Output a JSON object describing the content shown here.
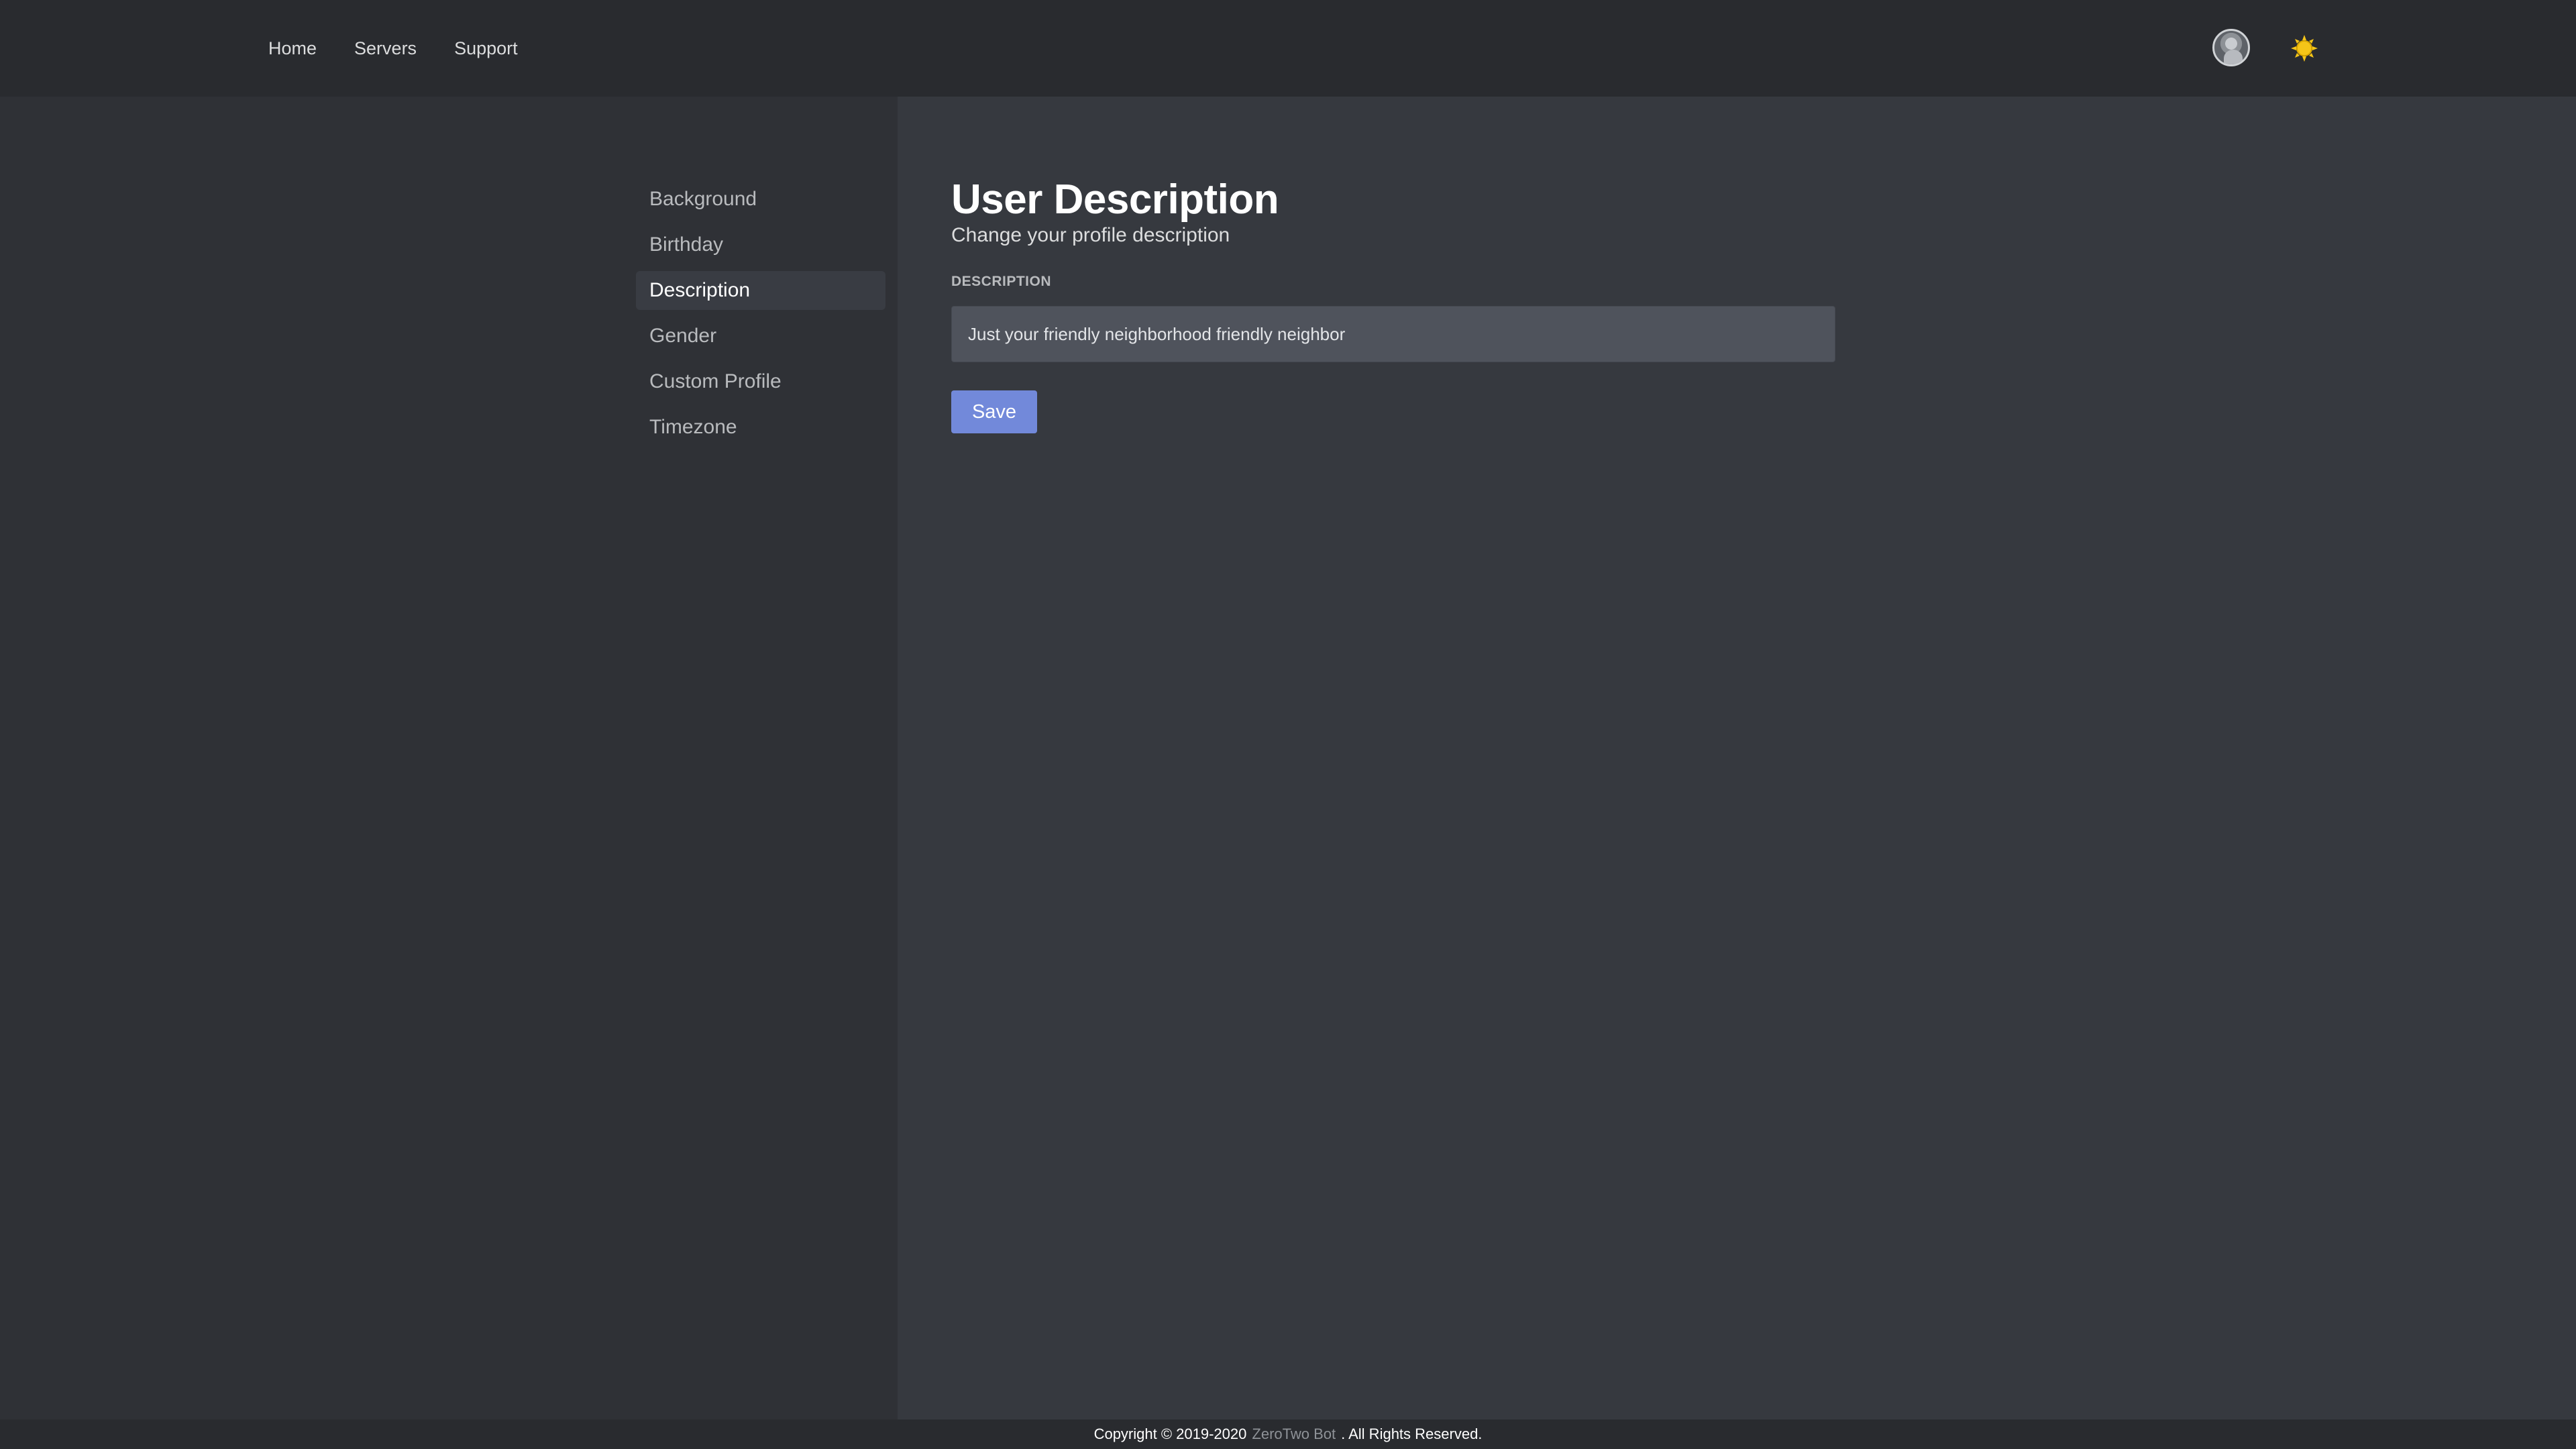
{
  "nav": {
    "links": [
      {
        "label": "Home"
      },
      {
        "label": "Servers"
      },
      {
        "label": "Support"
      }
    ],
    "avatar_icon": "user-avatar-icon",
    "theme_icon": "sun-icon",
    "theme_icon_color": "#f5c518"
  },
  "sidebar": {
    "items": [
      {
        "label": "Background",
        "active": false
      },
      {
        "label": "Birthday",
        "active": false
      },
      {
        "label": "Description",
        "active": true
      },
      {
        "label": "Gender",
        "active": false
      },
      {
        "label": "Custom Profile",
        "active": false
      },
      {
        "label": "Timezone",
        "active": false
      }
    ]
  },
  "main": {
    "title": "User Description",
    "subtitle": "Change your profile description",
    "field_label": "DESCRIPTION",
    "description_value": "Just your friendly neighborhood friendly neighbor",
    "save_label": "Save",
    "accent_color": "#7289da"
  },
  "footer": {
    "prefix": "Copyright © 2019-2020",
    "link": "ZeroTwo Bot",
    "suffix": ". All Rights Reserved."
  }
}
